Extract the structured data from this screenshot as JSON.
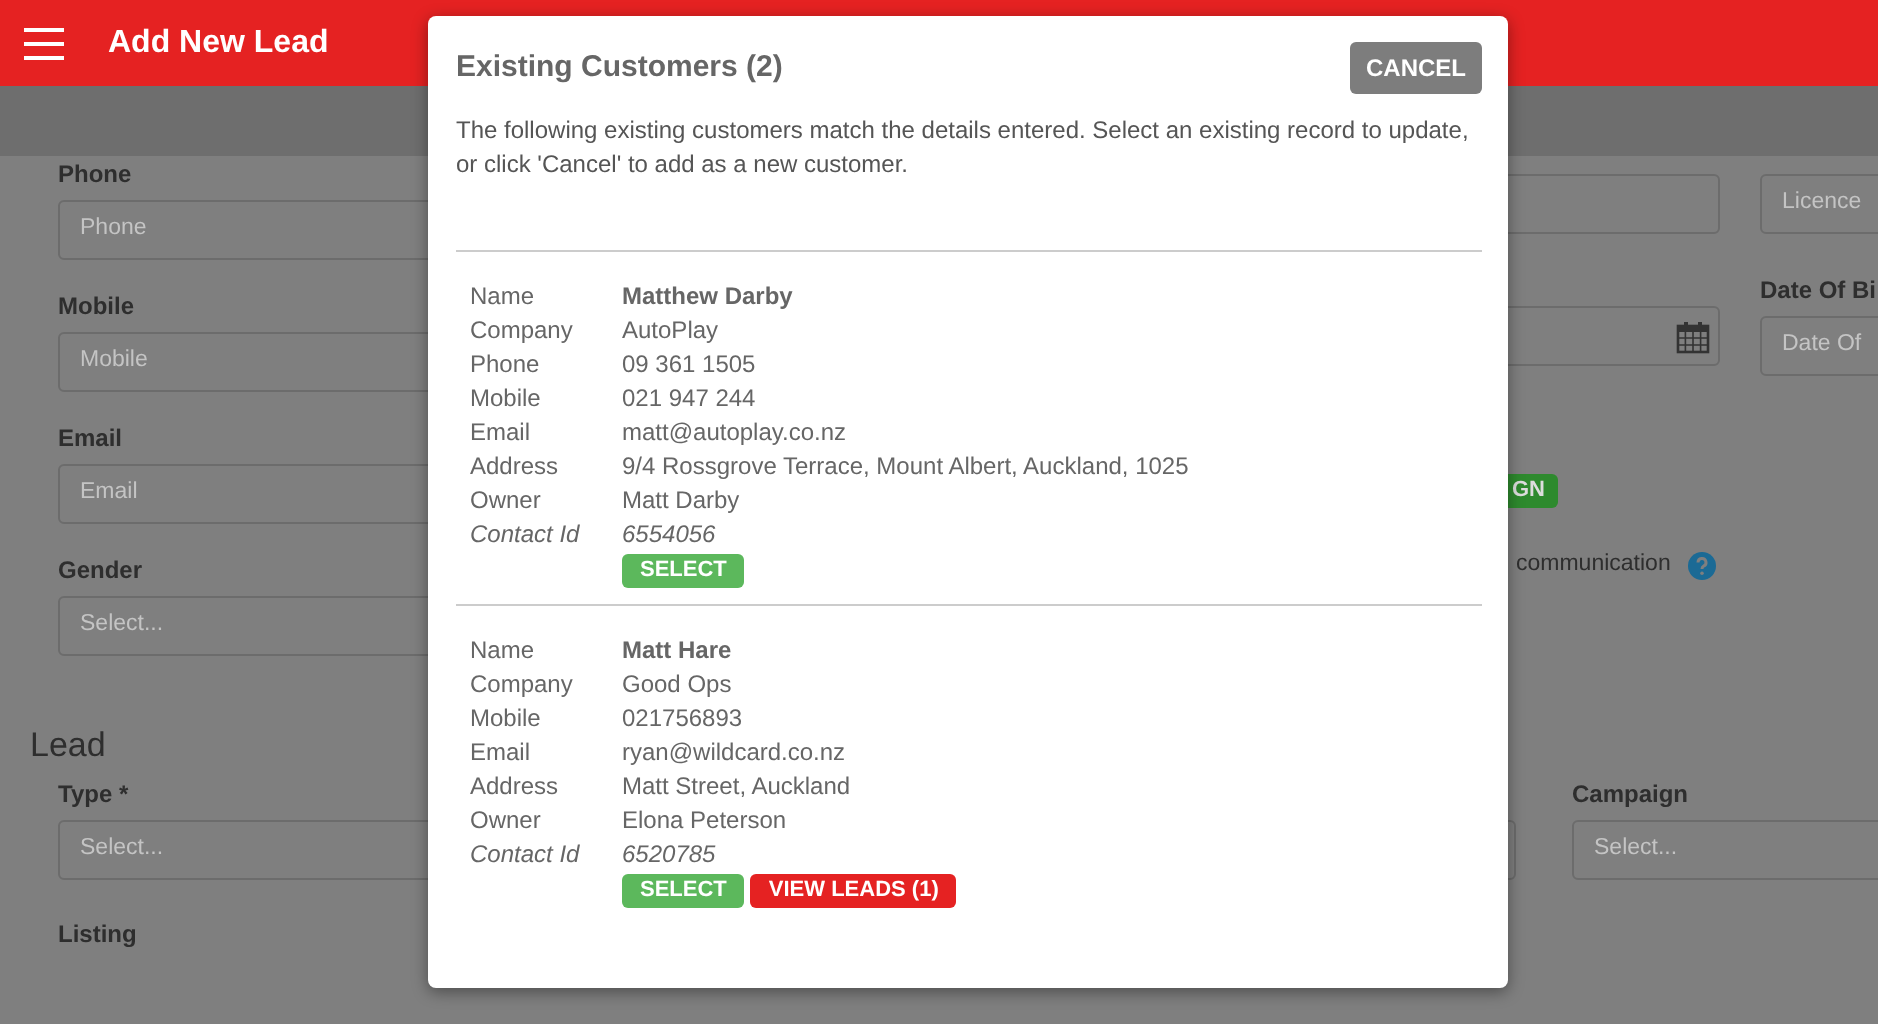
{
  "header": {
    "title": "Add New Lead"
  },
  "form": {
    "contact_fields": [
      {
        "label": "Phone",
        "placeholder": "Phone"
      },
      {
        "label": "Mobile",
        "placeholder": "Mobile"
      },
      {
        "label": "Email",
        "placeholder": "Email"
      },
      {
        "label": "Gender",
        "placeholder": "Select..."
      }
    ],
    "middle_fields": [
      {
        "kind": "text"
      },
      {
        "kind": "date"
      }
    ],
    "badge": "GN",
    "consent_text": "communication",
    "right_fields": [
      {
        "placeholder": "Licence"
      },
      {
        "label": "Date Of Bi",
        "placeholder": "Date Of"
      }
    ]
  },
  "lead_section": {
    "title": "Lead",
    "type_field": {
      "label": "Type *",
      "placeholder": "Select..."
    },
    "listing_label": "Listing",
    "campaign_field": {
      "label": "Campaign",
      "placeholder": "Select..."
    }
  },
  "modal": {
    "title": "Existing Customers (2)",
    "cancel": "CANCEL",
    "message": "The following existing customers match the details entered. Select an existing record to update, or click 'Cancel' to add as a new customer.",
    "customers": [
      {
        "fields": [
          {
            "label": "Name",
            "value": "Matthew Darby",
            "kind": "name"
          },
          {
            "label": "Company",
            "value": "AutoPlay",
            "kind": "plain"
          },
          {
            "label": "Phone",
            "value": "09 361 1505",
            "kind": "plain"
          },
          {
            "label": "Mobile",
            "value": "021 947 244",
            "kind": "plain"
          },
          {
            "label": "Email",
            "value": "matt@autoplay.co.nz",
            "kind": "plain"
          },
          {
            "label": "Address",
            "value": "9/4 Rossgrove Terrace, Mount Albert, Auckland, 1025",
            "kind": "plain"
          },
          {
            "label": "Owner",
            "value": "Matt Darby",
            "kind": "plain"
          },
          {
            "label": "Contact Id",
            "value": "6554056",
            "kind": "id"
          }
        ],
        "actions": [
          {
            "label": "SELECT",
            "kind": "select"
          }
        ]
      },
      {
        "fields": [
          {
            "label": "Name",
            "value": "Matt Hare",
            "kind": "name"
          },
          {
            "label": "Company",
            "value": "Good Ops",
            "kind": "plain"
          },
          {
            "label": "Mobile",
            "value": "021756893",
            "kind": "plain"
          },
          {
            "label": "Email",
            "value": "ryan@wildcard.co.nz",
            "kind": "plain"
          },
          {
            "label": "Address",
            "value": "Matt Street, Auckland",
            "kind": "plain"
          },
          {
            "label": "Owner",
            "value": "Elona Peterson",
            "kind": "plain"
          },
          {
            "label": "Contact Id",
            "value": "6520785",
            "kind": "id"
          }
        ],
        "actions": [
          {
            "label": "SELECT",
            "kind": "select"
          },
          {
            "label": "VIEW LEADS (1)",
            "kind": "leads"
          }
        ]
      }
    ]
  }
}
